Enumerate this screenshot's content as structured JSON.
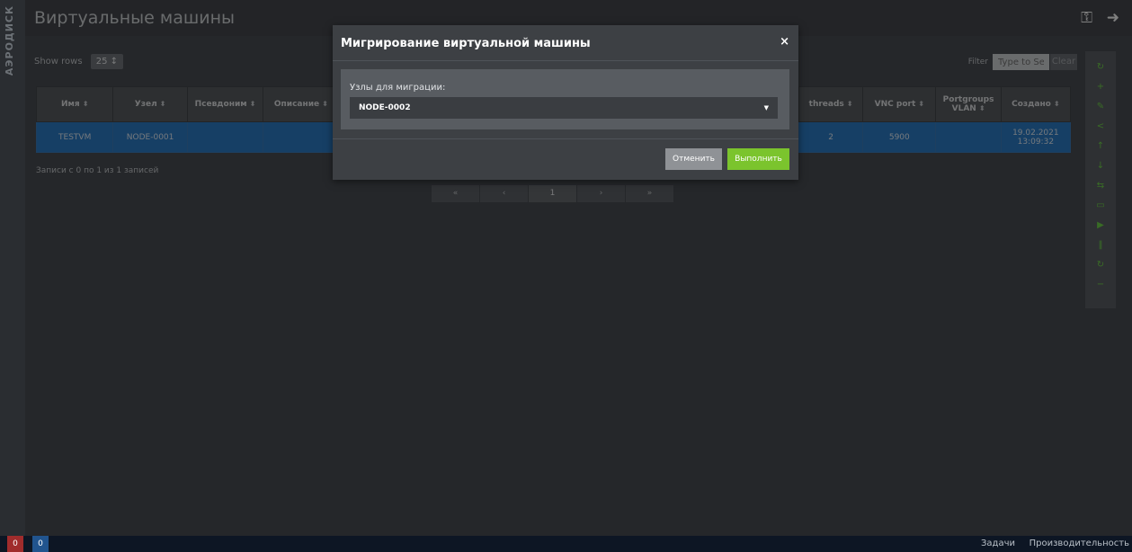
{
  "brand": "АЭРОДИСК",
  "header": {
    "title": "Виртуальные машины",
    "key_icon": "⚿",
    "logout_icon": "➜"
  },
  "controls": {
    "show_rows_label": "Show rows",
    "show_rows_value": "25 ↕",
    "filter_label": "Filter",
    "filter_placeholder": "Type to Search",
    "clear_label": "Clear"
  },
  "table": {
    "sort_glyph": "⬍",
    "columns": [
      "Имя",
      "Узел",
      "Псевдоним",
      "Описание",
      "",
      "",
      "",
      "",
      "",
      "",
      "threads",
      "VNC port",
      "Portgroups VLAN",
      "Создано"
    ],
    "rows": [
      [
        "TESTVM",
        "NODE-0001",
        "",
        "",
        "",
        "",
        "",
        "",
        "",
        "",
        "2",
        "5900",
        "",
        "19.02.2021 13:09:32"
      ]
    ]
  },
  "records_text": "Записи с 0 по 1 из 1 записей",
  "pager": {
    "first": "«",
    "prev": "‹",
    "current": "1",
    "next": "›",
    "last": "»"
  },
  "actions": {
    "refresh": "↻",
    "add": "+",
    "edit": "✎",
    "share": "<",
    "up": "↑",
    "down": "↓",
    "migrate": "⇆",
    "console": "▭",
    "play": "▶",
    "pause": "‖",
    "restart": "↻",
    "remove": "−"
  },
  "modal": {
    "title": "Мигрирование виртуальной машины",
    "close": "×",
    "field_label": "Узлы для миграции:",
    "selected_node": "NODE-0002",
    "caret": "▼",
    "cancel_label": "Отменить",
    "ok_label": "Выполнить"
  },
  "statusbar": {
    "errors_count": "0",
    "info_count": "0",
    "tasks_label": "Задачи",
    "performance_label": "Производительность"
  },
  "colors": {
    "accent_green": "#7bc42d",
    "selected_row": "#2c7fcb",
    "error_badge": "#a02c2c",
    "info_badge": "#21548e"
  }
}
